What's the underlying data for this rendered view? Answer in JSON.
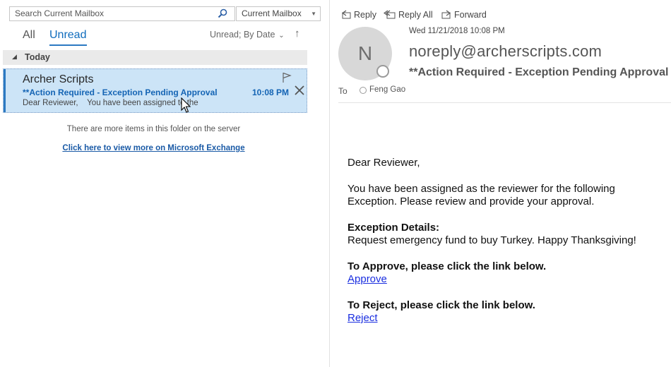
{
  "search": {
    "placeholder": "Search Current Mailbox",
    "scope": "Current Mailbox"
  },
  "filters": {
    "all": "All",
    "unread": "Unread",
    "sort": "Unread; By Date"
  },
  "group": {
    "label": "Today"
  },
  "message_list": [
    {
      "sender": "Archer Scripts",
      "subject": "**Action Required - Exception Pending Approval",
      "time": "10:08 PM",
      "preview": "Dear Reviewer,    You have been assigned to the"
    }
  ],
  "list_footer": {
    "note": "There are more items in this folder on the server",
    "link": "Click here to view more on Microsoft Exchange"
  },
  "reading_pane": {
    "actions": {
      "reply": "Reply",
      "reply_all": "Reply All",
      "forward": "Forward"
    },
    "avatar_initial": "N",
    "date": "Wed 11/21/2018 10:08 PM",
    "from": "noreply@archerscripts.com",
    "subject": "**Action Required - Exception Pending Approval",
    "to_label": "To",
    "recipient": "Feng Gao"
  },
  "body": {
    "greeting": "Dear Reviewer,",
    "intro_1": "You have been assigned as the reviewer for the following",
    "intro_2": "Exception. Please review and provide your approval.",
    "details_heading": "Exception Details:",
    "details_text": "Request emergency fund to buy Turkey. Happy Thanksgiving!",
    "approve_heading": "To Approve, please click the link below.",
    "approve_link": "Approve",
    "reject_heading": "To Reject, please click the link below.",
    "reject_link": "Reject"
  },
  "colors": {
    "accent": "#2b79c2",
    "selected_row": "#cce4f7",
    "link": "#1a2ee0",
    "unread_subject": "#1464b4"
  }
}
